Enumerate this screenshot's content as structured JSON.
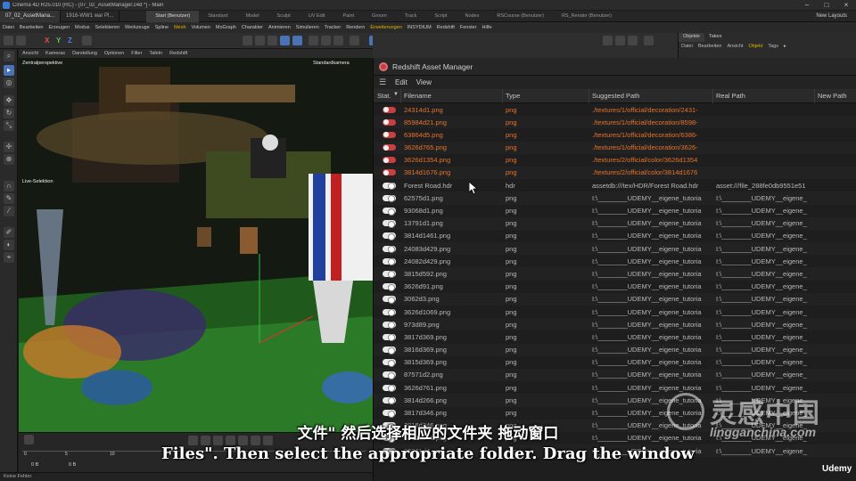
{
  "window": {
    "title": "Cinema 4D R25.010 (RC) - [07_02_AssetManager.c4d *] - Main",
    "controls": [
      "–",
      "□",
      "×"
    ]
  },
  "doc_tabs": [
    "07_02_AssetMana...",
    "1916-WW1 war Pl..."
  ],
  "layouts": {
    "items": [
      "Start (Benutzer)",
      "Standard",
      "Model",
      "Sculpt",
      "UV Edit",
      "Paint",
      "Groom",
      "Track",
      "Script",
      "Nodes",
      "RSCourse (Benutzer)",
      "RS_Render (Benutzer)"
    ],
    "active": "Start (Benutzer)",
    "new_layouts": "New Layouts"
  },
  "menubar": [
    "Datei",
    "Bearbeiten",
    "Erzeugen",
    "Modus",
    "Selektieren",
    "Werkzeuge",
    "Spline",
    "Mesh",
    "Volumen",
    "MoGraph",
    "Charakter",
    "Animieren",
    "Simulieren",
    "Tracker",
    "Rendern",
    "Erweiterungen",
    "INSYDIUM",
    "Redshift",
    "Fenster",
    "Hilfe"
  ],
  "toolbar_axes": [
    "X",
    "Y",
    "Z"
  ],
  "viewport": {
    "menu": [
      "Ansicht",
      "Kameras",
      "Darstellung",
      "Optionen",
      "Filter",
      "Tafeln",
      "Redshift"
    ],
    "perspective_label": "Zentralperspektive",
    "camera_label": "Standardkamera",
    "selection_label": "Live-Selektion"
  },
  "timeline": {
    "ticks": [
      "0",
      "5",
      "10"
    ],
    "frame_start": "0 B",
    "frame_current": "0 B"
  },
  "statusbar": {
    "text": "Keine Fehler."
  },
  "object_manager": {
    "tabs": [
      "Objekte",
      "Takes"
    ],
    "active_tab": "Objekte",
    "menu": [
      "Datei",
      "Bearbeiten",
      "Ansicht",
      "Objekt",
      "Tags",
      "▸"
    ]
  },
  "asset_manager": {
    "title": "Redshift Asset Manager",
    "menu": [
      "Edit",
      "View"
    ],
    "columns": [
      "Stat.",
      "Filename",
      "Type",
      "Suggested Path",
      "Real Path",
      "New Path"
    ],
    "rows": [
      {
        "status": "missing",
        "filename": "24314d1.png",
        "type": "png",
        "suggested": "./textures/1/official/decoration/2431-",
        "real": ""
      },
      {
        "status": "missing",
        "filename": "85984d21.png",
        "type": "png",
        "suggested": "./textures/1/official/decoration/8598-",
        "real": ""
      },
      {
        "status": "missing",
        "filename": "63864d5.png",
        "type": "png",
        "suggested": "./textures/1/official/decoration/6386-",
        "real": ""
      },
      {
        "status": "missing",
        "filename": "3626d765.png",
        "type": "png",
        "suggested": "./textures/1/official/decoration/3626-",
        "real": ""
      },
      {
        "status": "missing",
        "filename": "3626d1354.png",
        "type": "png",
        "suggested": "./textures/2/official/color/3626d1354",
        "real": ""
      },
      {
        "status": "missing",
        "filename": "3814d1676.png",
        "type": "png",
        "suggested": "./textures/2/official/color/3814d1676",
        "real": ""
      },
      {
        "status": "ok",
        "filename": "Forest Road.hdr",
        "type": "hdr",
        "suggested": "assetdb:///tex/HDR/Forest Road.hdr",
        "real": "asset:///file_288fe0db9551e51"
      },
      {
        "status": "ok",
        "filename": "62575d1.png",
        "type": "png",
        "suggested": "I:\\________UDEMY__eigene_tutoria",
        "real": "I:\\________UDEMY__eigene_"
      },
      {
        "status": "ok",
        "filename": "93068d1.png",
        "type": "png",
        "suggested": "I:\\________UDEMY__eigene_tutoria",
        "real": "I:\\________UDEMY__eigene_"
      },
      {
        "status": "ok",
        "filename": "13791d1.png",
        "type": "png",
        "suggested": "I:\\________UDEMY__eigene_tutoria",
        "real": "I:\\________UDEMY__eigene_"
      },
      {
        "status": "ok",
        "filename": "3814d1461.png",
        "type": "png",
        "suggested": "I:\\________UDEMY__eigene_tutoria",
        "real": "I:\\________UDEMY__eigene_"
      },
      {
        "status": "ok",
        "filename": "24083d429.png",
        "type": "png",
        "suggested": "I:\\________UDEMY__eigene_tutoria",
        "real": "I:\\________UDEMY__eigene_"
      },
      {
        "status": "ok",
        "filename": "24082d429.png",
        "type": "png",
        "suggested": "I:\\________UDEMY__eigene_tutoria",
        "real": "I:\\________UDEMY__eigene_"
      },
      {
        "status": "ok",
        "filename": "3815d592.png",
        "type": "png",
        "suggested": "I:\\________UDEMY__eigene_tutoria",
        "real": "I:\\________UDEMY__eigene_"
      },
      {
        "status": "ok",
        "filename": "3626d91.png",
        "type": "png",
        "suggested": "I:\\________UDEMY__eigene_tutoria",
        "real": "I:\\________UDEMY__eigene_"
      },
      {
        "status": "ok",
        "filename": "3062d3.png",
        "type": "png",
        "suggested": "I:\\________UDEMY__eigene_tutoria",
        "real": "I:\\________UDEMY__eigene_"
      },
      {
        "status": "ok",
        "filename": "3626d1069.png",
        "type": "png",
        "suggested": "I:\\________UDEMY__eigene_tutoria",
        "real": "I:\\________UDEMY__eigene_"
      },
      {
        "status": "ok",
        "filename": "973d89.png",
        "type": "png",
        "suggested": "I:\\________UDEMY__eigene_tutoria",
        "real": "I:\\________UDEMY__eigene_"
      },
      {
        "status": "ok",
        "filename": "3817d369.png",
        "type": "png",
        "suggested": "I:\\________UDEMY__eigene_tutoria",
        "real": "I:\\________UDEMY__eigene_"
      },
      {
        "status": "ok",
        "filename": "3816d369.png",
        "type": "png",
        "suggested": "I:\\________UDEMY__eigene_tutoria",
        "real": "I:\\________UDEMY__eigene_"
      },
      {
        "status": "ok",
        "filename": "3815d369.png",
        "type": "png",
        "suggested": "I:\\________UDEMY__eigene_tutoria",
        "real": "I:\\________UDEMY__eigene_"
      },
      {
        "status": "ok",
        "filename": "87571d2.png",
        "type": "png",
        "suggested": "I:\\________UDEMY__eigene_tutoria",
        "real": "I:\\________UDEMY__eigene_"
      },
      {
        "status": "ok",
        "filename": "3626d761.png",
        "type": "png",
        "suggested": "I:\\________UDEMY__eigene_tutoria",
        "real": "I:\\________UDEMY__eigene_"
      },
      {
        "status": "ok",
        "filename": "3814d266.png",
        "type": "png",
        "suggested": "I:\\________UDEMY__eigene_tutoria",
        "real": "I:\\________UDEMY__eigene_"
      },
      {
        "status": "ok",
        "filename": "3817d346.png",
        "type": "png",
        "suggested": "I:\\________UDEMY__eigene_tutoria",
        "real": "I:\\________UDEMY__eigene_"
      },
      {
        "status": "ok",
        "filename": "3816d346.png",
        "type": "png",
        "suggested": "I:\\________UDEMY__eigene_tutoria",
        "real": "I:\\________UDEMY__eigene_"
      },
      {
        "status": "ok",
        "filename": "3815d346.png",
        "type": "png",
        "suggested": "I:\\________UDEMY__eigene_tutoria",
        "real": "I:\\________UDEMY__eigene_"
      },
      {
        "status": "ok",
        "filename": "30361d4.png",
        "type": "png",
        "suggested": "I:\\________UDEMY__eigene_tutoria",
        "real": "I:\\________UDEMY__eigene_"
      }
    ]
  },
  "subtitles": {
    "chinese": "文件\" 然后选择相应的文件夹 拖动窗口",
    "english": "Files\". Then select the appropriate folder. Drag the window"
  },
  "watermark": {
    "cn": "灵感中国",
    "en": "lingganchina.com"
  },
  "udemy_logo": "Udemy",
  "colors": {
    "missing_text": "#e6732e",
    "missing_toggle": "#c84040",
    "selected_tool": "#4b72b5",
    "highlight_menu": "#e0b000"
  }
}
